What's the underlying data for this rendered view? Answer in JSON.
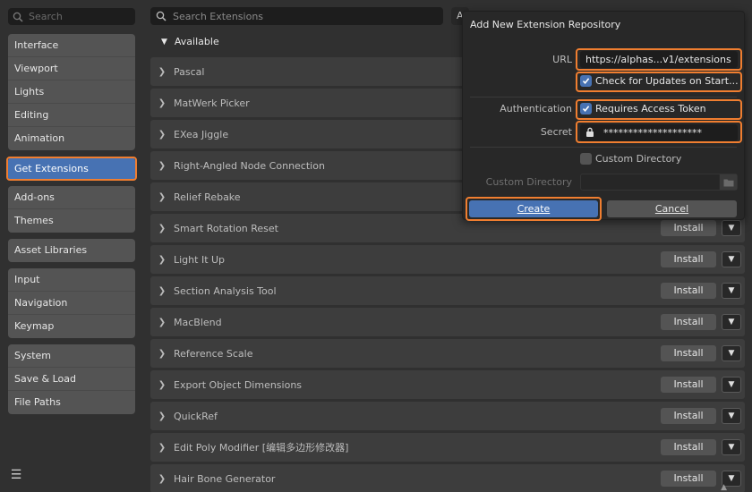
{
  "sidebar": {
    "search_placeholder": "Search",
    "groups": [
      [
        "Interface",
        "Viewport",
        "Lights",
        "Editing",
        "Animation"
      ],
      [
        "Get Extensions"
      ],
      [
        "Add-ons",
        "Themes"
      ],
      [
        "Asset Libraries"
      ],
      [
        "Input",
        "Navigation",
        "Keymap"
      ],
      [
        "System",
        "Save & Load",
        "File Paths"
      ]
    ],
    "active": "Get Extensions",
    "menu_icon": "hamburger-icon"
  },
  "main": {
    "search_placeholder": "Search Extensions",
    "sort_label": "A",
    "section_title": "Available",
    "install_label": "Install",
    "extensions": [
      "Pascal",
      "MatWerk Picker",
      "EXea Jiggle",
      "Right-Angled Node Connection",
      "Relief Rebake",
      "Smart Rotation Reset",
      "Light It Up",
      "Section Analysis Tool",
      "MacBlend",
      "Reference Scale",
      "Export Object Dimensions",
      "QuickRef",
      "Edit Poly Modifier [编辑多边形修改器]",
      "Hair Bone Generator"
    ]
  },
  "dialog": {
    "title": "Add New Extension Repository",
    "url_label": "URL",
    "url_value": "https://alphas...v1/extensions",
    "check_updates_label": "Check for Updates on Start...",
    "check_updates_checked": true,
    "auth_label": "Authentication",
    "requires_token_label": "Requires Access Token",
    "requires_token_checked": true,
    "secret_label": "Secret",
    "secret_value": "********************",
    "custom_dir_label": "Custom Directory",
    "custom_dir_checked": false,
    "custom_dir_field_label": "Custom Directory",
    "create_label": "Create",
    "cancel_label": "Cancel"
  },
  "colors": {
    "accent": "#4772b3",
    "highlight": "#f07e30",
    "background": "#303030"
  }
}
